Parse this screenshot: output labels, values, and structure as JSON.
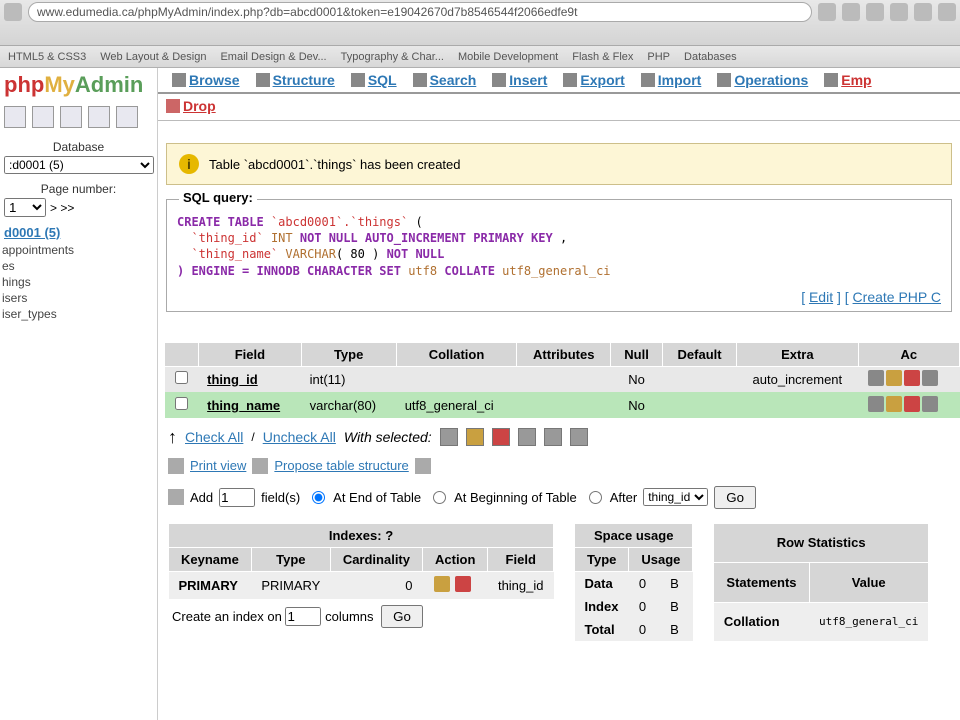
{
  "browser": {
    "url": "www.edumedia.ca/phpMyAdmin/index.php?db=abcd0001&token=e19042670d7b8546544f2066edfe9t"
  },
  "favorites": [
    "HTML5 & CSS3",
    "Web Layout & Design",
    "Email Design & Dev...",
    "Typography & Char...",
    "Mobile Development",
    "Flash & Flex",
    "PHP",
    "Databases"
  ],
  "logo": {
    "p1": "php",
    "p2": "My",
    "p3": "Admin"
  },
  "sidebar": {
    "database_label": "Database",
    "db_select": ":d0001 (5)",
    "page_label": "Page number:",
    "page_value": "1",
    "page_nav": "> >>",
    "db_name": "d0001 (5)",
    "tables": [
      "appointments",
      "es",
      "hings",
      "isers",
      "iser_types"
    ]
  },
  "tabs": [
    "Browse",
    "Structure",
    "SQL",
    "Search",
    "Insert",
    "Export",
    "Import",
    "Operations",
    "Emp"
  ],
  "drop": "Drop",
  "notice": "Table `abcd0001`.`things` has been created",
  "sql": {
    "legend": "SQL query:",
    "line1a": "CREATE TABLE",
    "line1b": "`abcd0001`.`things`",
    "line2a": "`thing_id`",
    "line2b": "INT",
    "line2c": "NOT NULL AUTO_INCREMENT PRIMARY KEY",
    "line3a": "`thing_name`",
    "line3b": "VARCHAR",
    "line3c": "( 80 )",
    "line3d": "NOT NULL",
    "line4a": ") ENGINE = INNODB CHARACTER SET",
    "line4b": "utf8",
    "line4c": "COLLATE",
    "line4d": "utf8_general_ci",
    "edit": "Edit",
    "createphp": "Create PHP C"
  },
  "struct": {
    "headers": [
      "Field",
      "Type",
      "Collation",
      "Attributes",
      "Null",
      "Default",
      "Extra",
      "Ac"
    ],
    "rows": [
      {
        "field": "thing_id",
        "type": "int(11)",
        "collation": "",
        "attributes": "",
        "null": "No",
        "default": "",
        "extra": "auto_increment"
      },
      {
        "field": "thing_name",
        "type": "varchar(80)",
        "collation": "utf8_general_ci",
        "attributes": "",
        "null": "No",
        "default": "",
        "extra": ""
      }
    ],
    "check_all": "Check All",
    "uncheck_all": "Uncheck All",
    "with_selected": "With selected:"
  },
  "print_view": "Print view",
  "propose": "Propose table structure",
  "add": {
    "label": "Add",
    "value": "1",
    "fields": "field(s)",
    "at_end": "At End of Table",
    "at_begin": "At Beginning of Table",
    "after": "After",
    "after_field": "thing_id",
    "go": "Go"
  },
  "indexes": {
    "title": "Indexes:",
    "headers": [
      "Keyname",
      "Type",
      "Cardinality",
      "Action",
      "Field"
    ],
    "rows": [
      {
        "keyname": "PRIMARY",
        "type": "PRIMARY",
        "card": "0",
        "field": "thing_id"
      }
    ],
    "create_a": "Create an index on",
    "create_val": "1",
    "create_b": "columns",
    "go": "Go"
  },
  "space": {
    "title": "Space usage",
    "headers": [
      "Type",
      "Usage"
    ],
    "rows": [
      {
        "type": "Data",
        "val": "0",
        "unit": "B"
      },
      {
        "type": "Index",
        "val": "0",
        "unit": "B"
      },
      {
        "type": "Total",
        "val": "0",
        "unit": "B"
      }
    ]
  },
  "rowstats": {
    "title": "Row Statistics",
    "headers": [
      "Statements",
      "Value"
    ],
    "rows": [
      {
        "stmt": "Collation",
        "val": "utf8_general_ci"
      }
    ]
  }
}
